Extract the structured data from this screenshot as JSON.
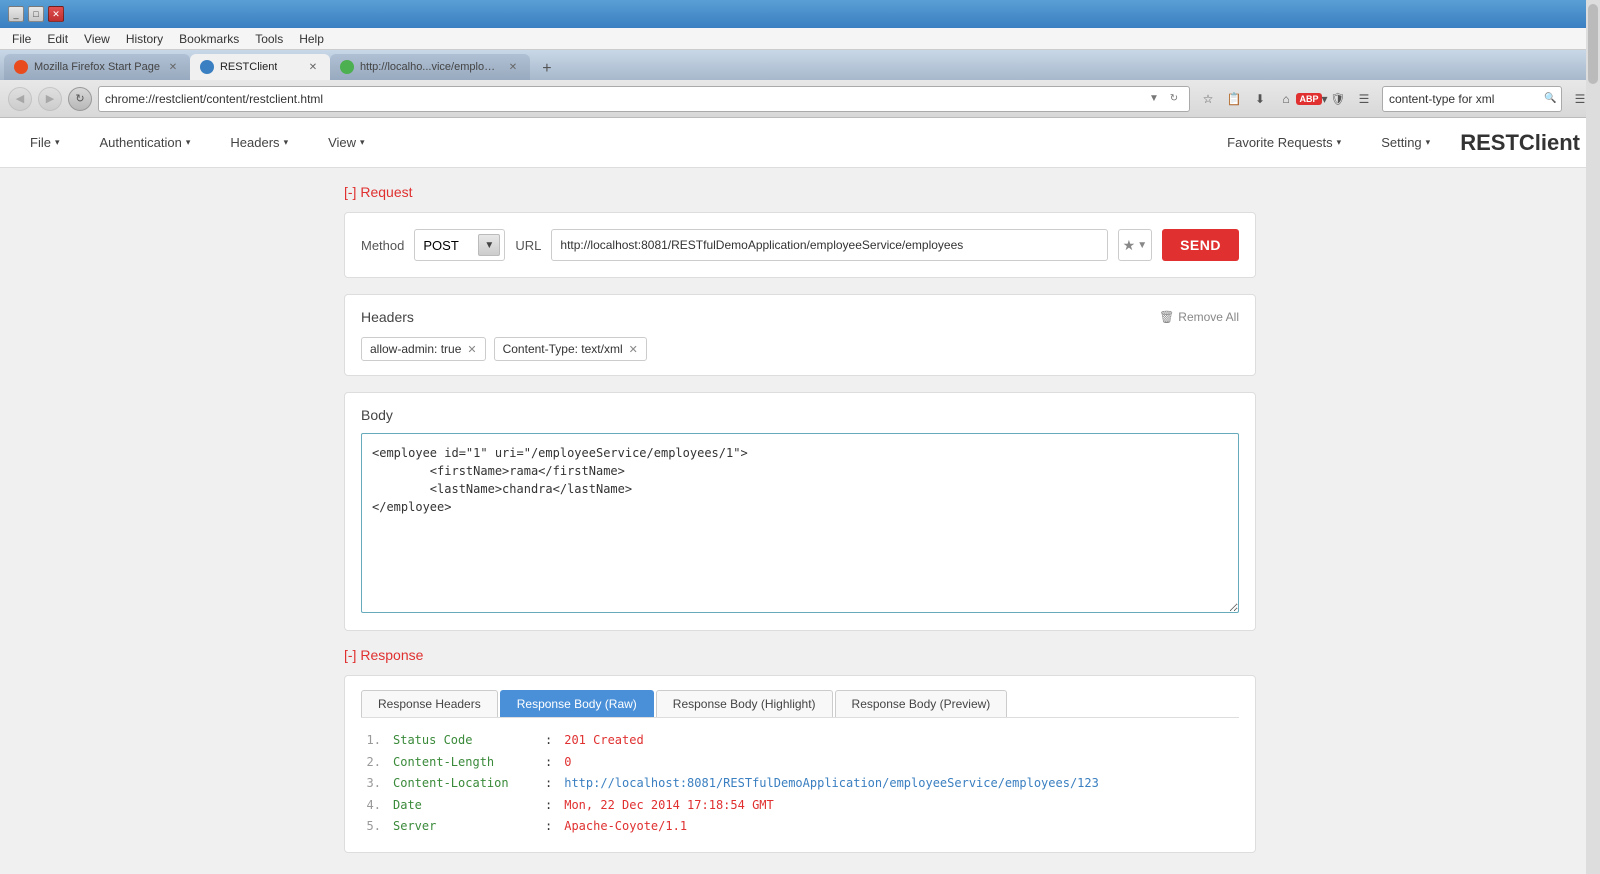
{
  "browser": {
    "tabs": [
      {
        "id": "firefox-tab",
        "label": "Mozilla Firefox Start Page",
        "icon": "firefox",
        "active": false
      },
      {
        "id": "restclient-tab",
        "label": "RESTClient",
        "icon": "restclient",
        "active": true
      },
      {
        "id": "url-tab",
        "label": "http://localho...vice/employees",
        "icon": "url-tab",
        "active": false
      }
    ],
    "url": "chrome://restclient/content/restclient.html",
    "search_value": "content-type for xml",
    "menu_items": [
      "File",
      "Edit",
      "View",
      "History",
      "Bookmarks",
      "Tools",
      "Help"
    ]
  },
  "app": {
    "title": "RESTClient",
    "nav_items": [
      {
        "label": "File",
        "has_dropdown": true
      },
      {
        "label": "Authentication",
        "has_dropdown": true
      },
      {
        "label": "Headers",
        "has_dropdown": true
      },
      {
        "label": "View",
        "has_dropdown": true
      }
    ],
    "right_nav": [
      {
        "label": "Favorite Requests",
        "has_dropdown": true
      },
      {
        "label": "Setting",
        "has_dropdown": true
      }
    ]
  },
  "request": {
    "section_label": "[-] Request",
    "method_label": "Method",
    "method_value": "POST",
    "url_label": "URL",
    "url_value": "http://localhost:8081/RESTfulDemoApplication/employeeService/employees",
    "send_label": "SEND"
  },
  "headers": {
    "section_label": "Headers",
    "remove_all_label": "Remove All",
    "tags": [
      {
        "value": "allow-admin: true"
      },
      {
        "value": "Content-Type: text/xml"
      }
    ]
  },
  "body": {
    "section_label": "Body",
    "content": "<employee id=\"1\" uri=\"/employeeService/employees/1\">\n        <firstName>rama</firstName>\n        <lastName>chandra</lastName>\n</employee>"
  },
  "response": {
    "section_label": "[-] Response",
    "tabs": [
      {
        "label": "Response Headers",
        "active": false
      },
      {
        "label": "Response Body (Raw)",
        "active": true
      },
      {
        "label": "Response Body (Highlight)",
        "active": false
      },
      {
        "label": "Response Body (Preview)",
        "active": false
      }
    ],
    "lines": [
      {
        "num": "1.",
        "key": "Status Code",
        "sep": ":",
        "val": "201 Created",
        "link": false
      },
      {
        "num": "2.",
        "key": "Content-Length",
        "sep": ":",
        "val": "0",
        "link": false
      },
      {
        "num": "3.",
        "key": "Content-Location",
        "sep": ":",
        "val": "http://localhost:8081/RESTfulDemoApplication/employeeService/employees/123",
        "link": true
      },
      {
        "num": "4.",
        "key": "Date",
        "sep": ":",
        "val": "Mon, 22 Dec 2014 17:18:54 GMT",
        "link": false
      },
      {
        "num": "5.",
        "key": "Server",
        "sep": ":",
        "val": "Apache-Coyote/1.1",
        "link": false
      }
    ]
  }
}
